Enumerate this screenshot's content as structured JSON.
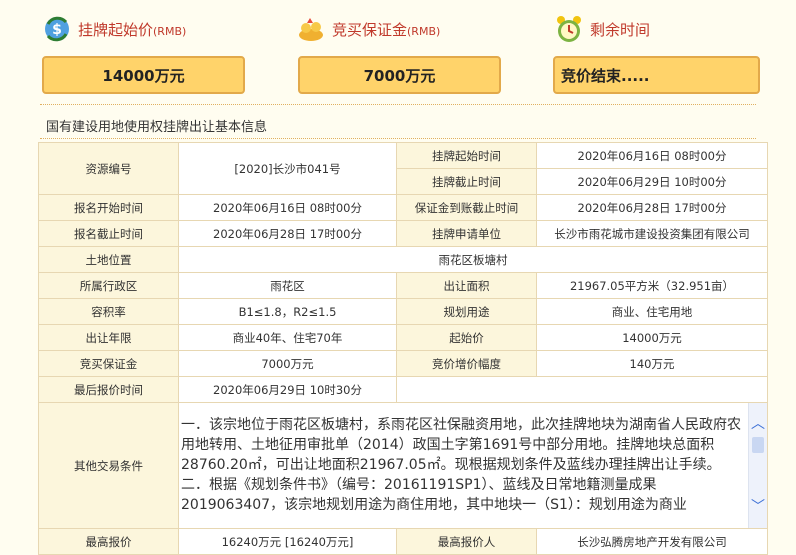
{
  "header": {
    "start_price_label": "挂牌起始价",
    "deposit_label": "竞买保证金",
    "rmb_tag": "(RMB)",
    "remaining_label": "剩余时间"
  },
  "boxes": {
    "start_price": "14000万元",
    "deposit": "7000万元",
    "remaining": "竞价结束....."
  },
  "section_title": "国有建设用地使用权挂牌出让基本信息",
  "table": {
    "resource_no_key": "资源编号",
    "resource_no_val": "[2020]长沙市041号",
    "listing_start_key": "挂牌起始时间",
    "listing_start_val": "2020年06月16日 08时00分",
    "listing_end_key": "挂牌截止时间",
    "listing_end_val": "2020年06月29日 10时00分",
    "reg_start_key": "报名开始时间",
    "reg_start_val": "2020年06月16日 08时00分",
    "deposit_due_key": "保证金到账截止时间",
    "deposit_due_val": "2020年06月28日 17时00分",
    "reg_end_key": "报名截止时间",
    "reg_end_val": "2020年06月28日 17时00分",
    "applicant_key": "挂牌申请单位",
    "applicant_val": "长沙市雨花城市建设投资集团有限公司",
    "location_key": "土地位置",
    "location_val": "雨花区板塘村",
    "district_key": "所属行政区",
    "district_val": "雨花区",
    "area_key": "出让面积",
    "area_val": "21967.05平方米（32.951亩）",
    "far_key": "容积率",
    "far_val": "B1≤1.8，R2≤1.5",
    "usage_key": "规划用途",
    "usage_val": "商业、住宅用地",
    "term_key": "出让年限",
    "term_val": "商业40年、住宅70年",
    "start_price_key": "起始价",
    "start_price_val": "14000万元",
    "deposit_key": "竞买保证金",
    "deposit_val": "7000万元",
    "increment_key": "竞价增价幅度",
    "increment_val": "140万元",
    "last_bid_time_key": "最后报价时间",
    "last_bid_time_val": "2020年06月29日 10时30分",
    "other_key": "其他交易条件",
    "other_p1": "一．该宗地位于雨花区板塘村，系雨花区社保融资用地，此次挂牌地块为湖南省人民政府农用地转用、土地征用审批单（2014）政国土字第1691号中部分用地。挂牌地块总面积28760.20㎡，可出让地面积21967.05㎡。现根据规划条件及蓝线办理挂牌出让手续。",
    "other_p2": "二．根据《规划条件书》（编号：20161191SP1）、蓝线及日常地籍测量成果2019063407，该宗地规划用途为商住用地，其中地块一（S1）：规划用途为商业",
    "highest_bid_key": "最高报价",
    "highest_bid_val": "16240万元 [16240万元]",
    "highest_bidder_key": "最高报价人",
    "highest_bidder_val": "长沙弘腾房地产开发有限公司"
  },
  "icons": {
    "start_price": "dollar-refresh-icon",
    "deposit": "money-gift-icon",
    "remaining": "alarm-clock-icon",
    "scroll_up": "chevron-up-icon",
    "scroll_down": "chevron-down-icon"
  },
  "colors": {
    "label_red": "#c0392b",
    "box_fill": "#ffd36a",
    "box_border": "#e2a94a",
    "key_cell_bg": "#fcf6dc"
  }
}
